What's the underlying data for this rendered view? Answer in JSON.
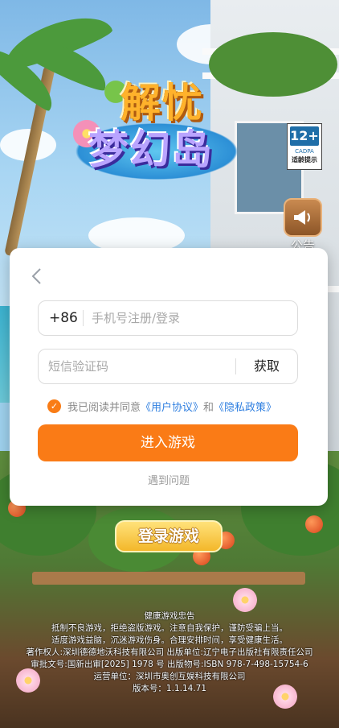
{
  "game": {
    "logo_line1": "解忧",
    "logo_line2": "梦幻岛"
  },
  "age_rating": {
    "value": "12+",
    "org": "CADPA",
    "label": "适龄提示"
  },
  "notice": {
    "icon": "megaphone-icon",
    "label": "公告"
  },
  "login_dialog": {
    "back_icon": "chevron-left-icon",
    "phone_prefix": "+86",
    "phone_placeholder": "手机号注册/登录",
    "code_placeholder": "短信验证码",
    "get_code_label": "获取",
    "agreement": {
      "checked": true,
      "prefix": "我已阅读并同意",
      "user_agreement": "《用户协议》",
      "conjunction": "和",
      "privacy_policy": "《隐私政策》"
    },
    "enter_button": "进入游戏",
    "problem_link": "遇到问题"
  },
  "login_game_button": "登录游戏",
  "advisory": {
    "title": "健康游戏忠告",
    "line1": "抵制不良游戏，拒绝盗版游戏。注意自我保护，谨防受骗上当。",
    "line2": "适度游戏益脑，沉迷游戏伤身。合理安排时间，享受健康生活。",
    "copyright": "著作权人:深圳德德地沃科技有限公司 出版单位:辽宁电子出版社有限责任公司",
    "approval": "审批文号:国新出审[2025] 1978 号 出版物号:ISBN 978-7-498-15754-6",
    "operator": "运营单位：深圳市奥创互娱科技有限公司",
    "version": "版本号：1.1.14.71"
  },
  "colors": {
    "accent": "#fa7b16",
    "link": "#2f7fe0",
    "placeholder": "#a8a8a8"
  }
}
